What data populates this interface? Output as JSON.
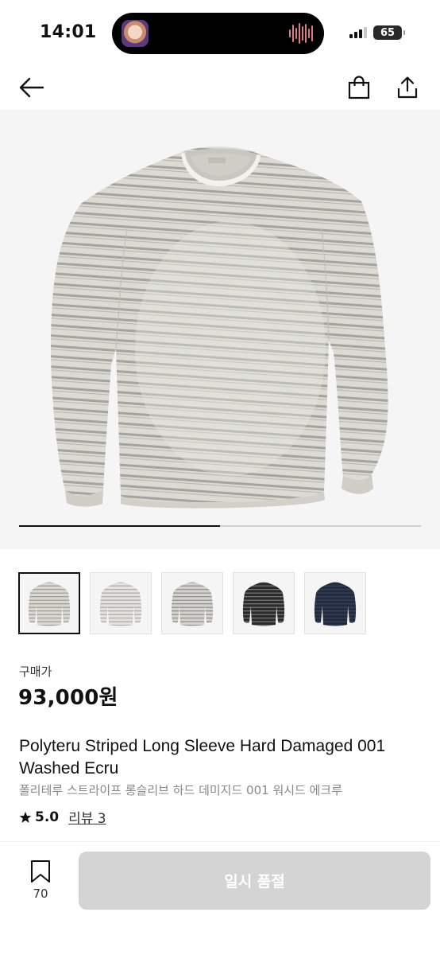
{
  "status_bar": {
    "time": "14:01",
    "battery": "65"
  },
  "nav": {
    "back_icon": "arrow-left-icon",
    "shop_icon": "shopping-bag-icon",
    "share_icon": "share-icon"
  },
  "gallery": {
    "progress": 0.5,
    "thumbnails": [
      {
        "label": "ecru-washed",
        "body": "#d9d7cf",
        "stripe": "#9a9b97",
        "selected": true
      },
      {
        "label": "ecru-light",
        "body": "#e3e2dc",
        "stripe": "#a9aaa6",
        "selected": false
      },
      {
        "label": "grey",
        "body": "#d4d2cc",
        "stripe": "#8e8d8a",
        "selected": false
      },
      {
        "label": "black",
        "body": "#2a2a2a",
        "stripe": "#7a7a7a",
        "selected": false
      },
      {
        "label": "navy",
        "body": "#222a3f",
        "stripe": "#3a4358",
        "selected": false
      }
    ]
  },
  "product": {
    "price_label": "구매가",
    "price": "93,000원",
    "title_en": "Polyteru Striped Long Sleeve Hard Damaged 001 Washed Ecru",
    "title_ko": "폴리테루 스트라이프 롱슬리브 하드 데미지드 001 워시드 에크루",
    "rating": "5.0",
    "reviews": "리뷰 3"
  },
  "bottom_bar": {
    "like_count": "70",
    "soldout_label": "일시 품절"
  },
  "colors": {
    "accent": "#111111",
    "disabled_button": "#d4d4d4",
    "hero_bg": "#f5f5f5"
  }
}
